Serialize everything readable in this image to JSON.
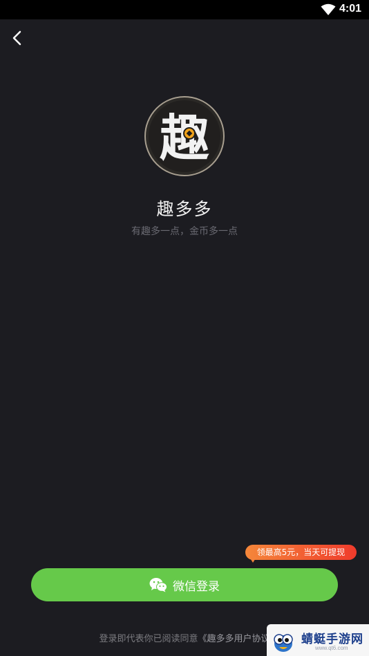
{
  "status_bar": {
    "time": "4:01",
    "icons": [
      "wifi-icon"
    ]
  },
  "nav": {
    "back_icon": "chevron-left-icon"
  },
  "app": {
    "logo_char": "趣",
    "name": "趣多多",
    "slogan": "有趣多一点，金币多一点"
  },
  "promo": {
    "badge_text": "领最高5元，当天可提现"
  },
  "login": {
    "button_label": "微信登录",
    "icon": "wechat-icon"
  },
  "agreement": {
    "prefix": "登录即代表你已阅读同意",
    "link_text": "《趣多多用户协议"
  },
  "watermark": {
    "title": "蜻蜓手游网",
    "domain": "www.qt6.com"
  },
  "colors": {
    "background": "#1c1c21",
    "button": "#66c94a",
    "badge_start": "#f5873a",
    "badge_end": "#ef3b2c"
  }
}
